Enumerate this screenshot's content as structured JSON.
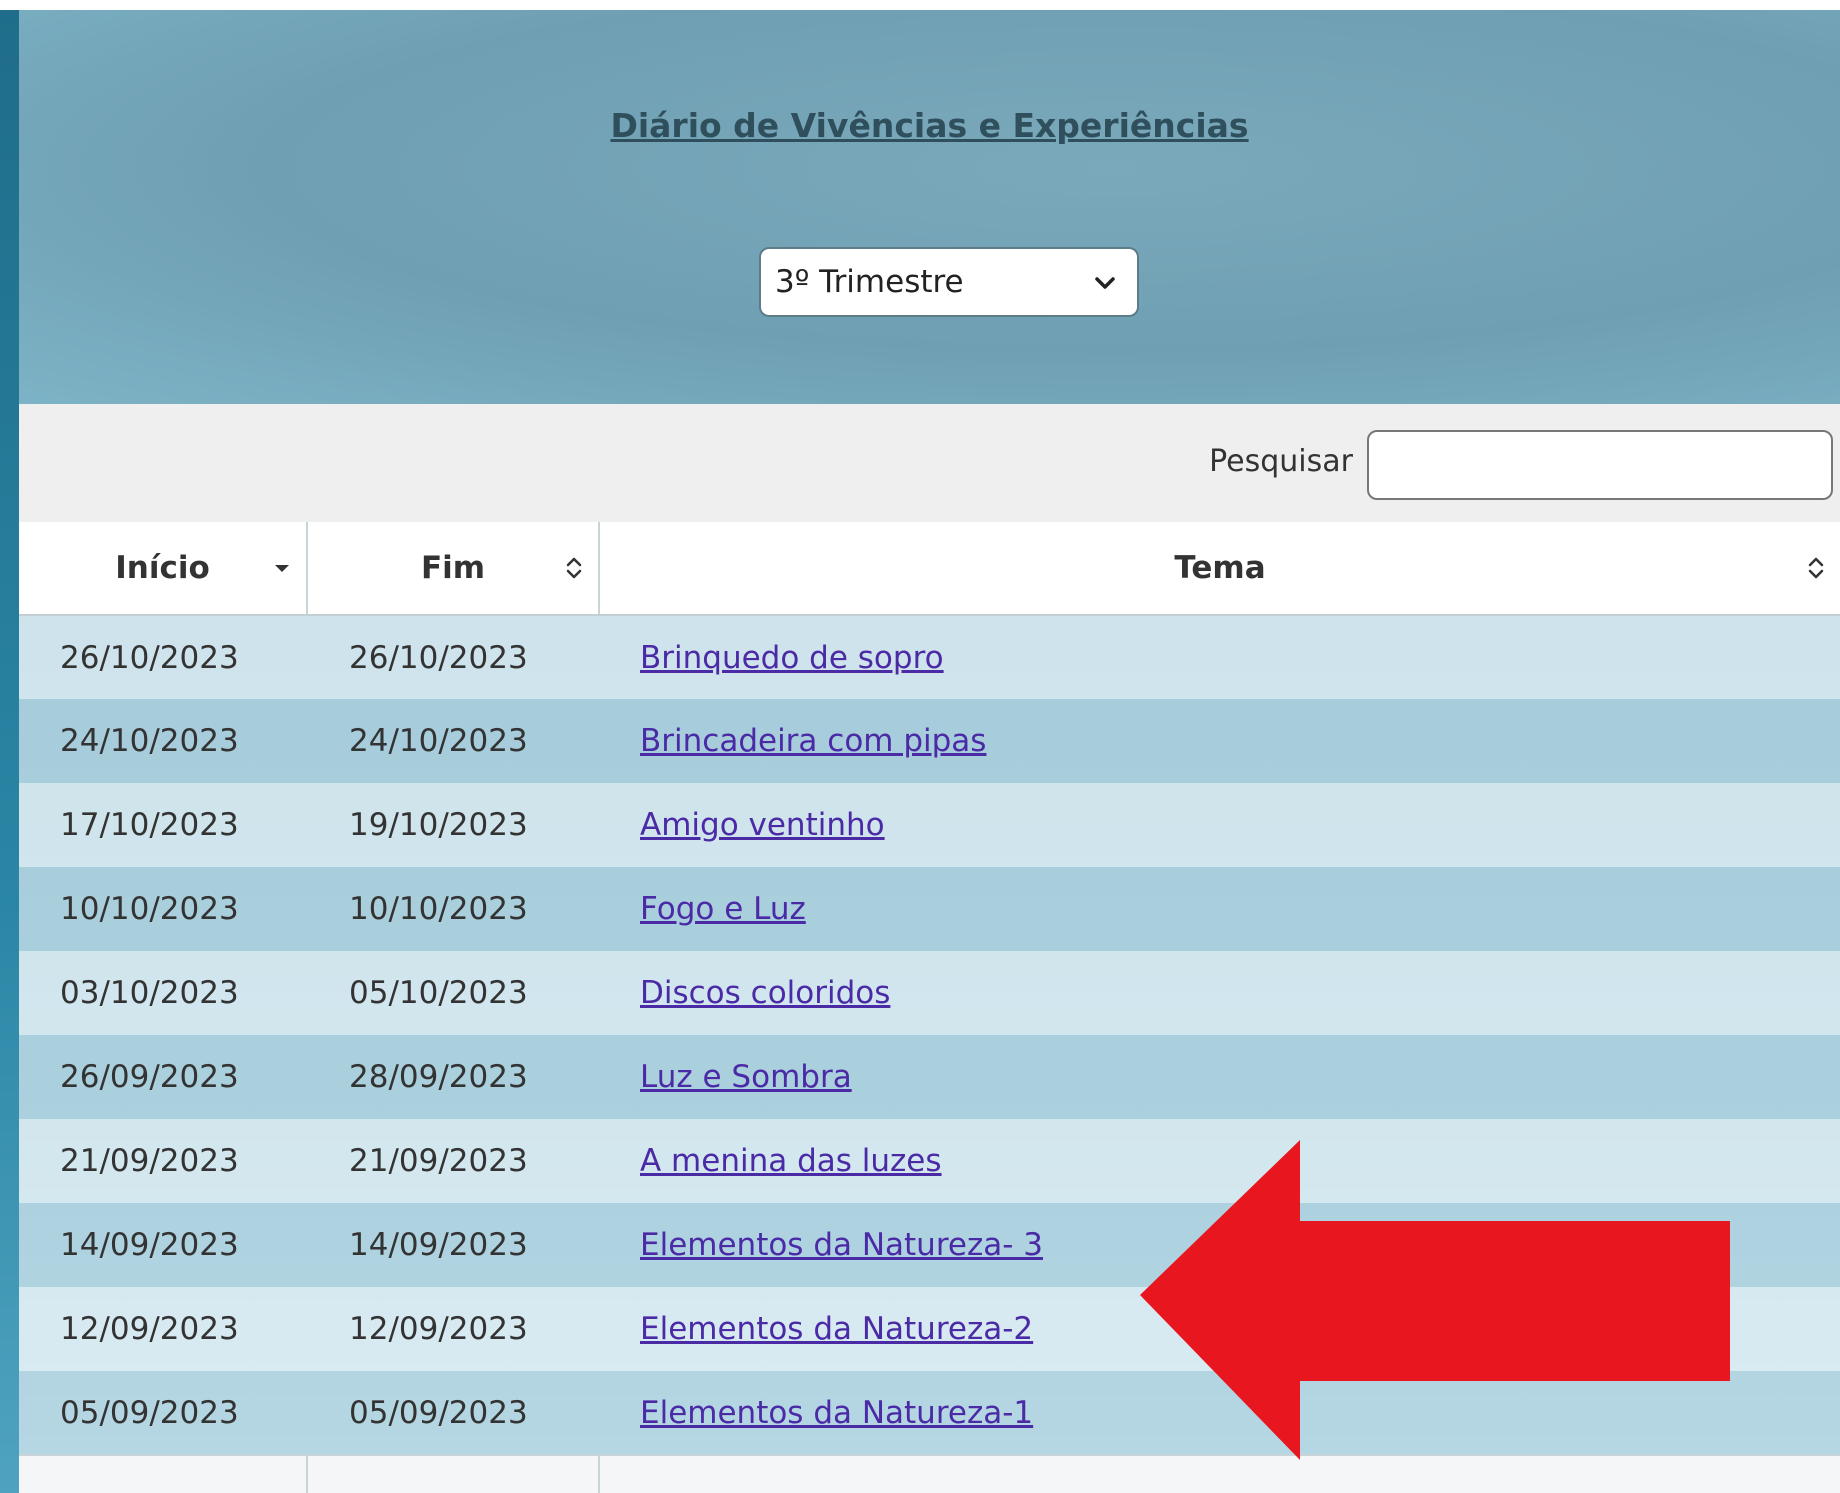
{
  "header": {
    "title": "Diário de Vivências e Experiências",
    "period_select": {
      "selected": "3º Trimestre"
    }
  },
  "toolbar": {
    "search_label": "Pesquisar",
    "search_value": ""
  },
  "table": {
    "columns": [
      {
        "label": "Início",
        "sort": "desc"
      },
      {
        "label": "Fim",
        "sort": "none"
      },
      {
        "label": "Tema",
        "sort": "none"
      }
    ],
    "rows": [
      {
        "inicio": "26/10/2023",
        "fim": "26/10/2023",
        "tema": "Brinquedo de sopro"
      },
      {
        "inicio": "24/10/2023",
        "fim": "24/10/2023",
        "tema": "Brincadeira com pipas"
      },
      {
        "inicio": "17/10/2023",
        "fim": "19/10/2023",
        "tema": "Amigo ventinho"
      },
      {
        "inicio": "10/10/2023",
        "fim": "10/10/2023",
        "tema": "Fogo e Luz"
      },
      {
        "inicio": "03/10/2023",
        "fim": "05/10/2023",
        "tema": "Discos coloridos"
      },
      {
        "inicio": "26/09/2023",
        "fim": "28/09/2023",
        "tema": "Luz e Sombra"
      },
      {
        "inicio": "21/09/2023",
        "fim": "21/09/2023",
        "tema": "A menina das luzes"
      },
      {
        "inicio": "14/09/2023",
        "fim": "14/09/2023",
        "tema": "Elementos da Natureza- 3"
      },
      {
        "inicio": "12/09/2023",
        "fim": "12/09/2023",
        "tema": "Elementos da Natureza-2"
      },
      {
        "inicio": "05/09/2023",
        "fim": "05/09/2023",
        "tema": "Elementos da Natureza-1"
      }
    ]
  },
  "annotation": {
    "icon": "red-left-arrow-icon",
    "color": "#e8161f"
  },
  "colors": {
    "link": "#4b2aa6",
    "header_bg": "#7aa9bb",
    "row_light": "#e6f1f6",
    "row_dark": "#b5d5e2"
  }
}
